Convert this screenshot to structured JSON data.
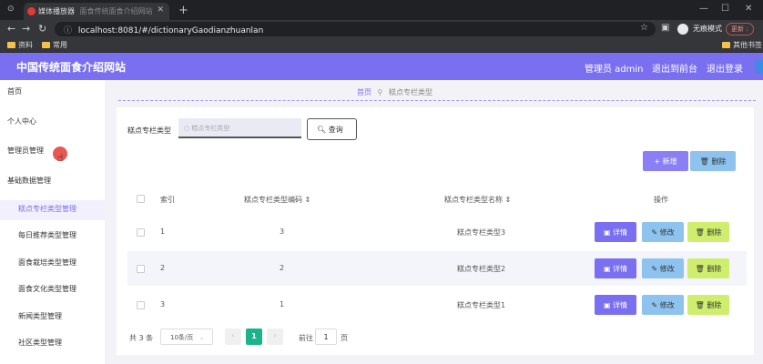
{
  "browser": {
    "tab_title": "媒体播放器",
    "tab_subtitle": "面食传统面食介绍网站",
    "url": "localhost:8081/#/dictionaryGaodianzhuanlan",
    "incognito_label": "无痕模式",
    "update_label": "更新 :",
    "bookmarks": [
      "资料",
      "常用"
    ],
    "other_bookmarks": "其他书签"
  },
  "header": {
    "title": "中国传统面食介绍网站",
    "admin": "管理员 admin",
    "back_front": "退出到前台",
    "logout": "退出登录"
  },
  "sidebar": {
    "items": [
      {
        "label": "首页"
      },
      {
        "label": "个人中心"
      },
      {
        "label": "管理员管理"
      },
      {
        "label": "基础数据管理"
      }
    ],
    "subitems": [
      {
        "label": "糕点专栏类型管理"
      },
      {
        "label": "每日推荐类型管理"
      },
      {
        "label": "面食栽培类型管理"
      },
      {
        "label": "面食文化类型管理"
      },
      {
        "label": "新闻类型管理"
      },
      {
        "label": "社区类型管理"
      }
    ]
  },
  "breadcrumb": {
    "home": "首页",
    "current": "糕点专栏类型"
  },
  "search": {
    "label": "糕点专栏类型",
    "placeholder": "糕点专栏类型",
    "button": "查询"
  },
  "actions": {
    "add": "+ 新增",
    "delete": "删除"
  },
  "table": {
    "headers": {
      "index": "索引",
      "code": "糕点专栏类型编码",
      "name": "糕点专栏类型名称",
      "ops": "操作"
    },
    "rows": [
      {
        "index": "1",
        "code": "3",
        "name": "糕点专栏类型3"
      },
      {
        "index": "2",
        "code": "2",
        "name": "糕点专栏类型2"
      },
      {
        "index": "3",
        "code": "1",
        "name": "糕点专栏类型1"
      }
    ],
    "row_buttons": {
      "detail": "详情",
      "edit": "修改",
      "delete": "删除"
    }
  },
  "pagination": {
    "total": "共 3 条",
    "page_size": "10条/页",
    "current_page": "1",
    "goto_prefix": "前往",
    "goto_value": "1",
    "goto_suffix": "页"
  },
  "colors": {
    "accent": "#7a6ff0",
    "edit": "#8ec3ef",
    "delete": "#cfee6d",
    "page": "#1db38a"
  }
}
